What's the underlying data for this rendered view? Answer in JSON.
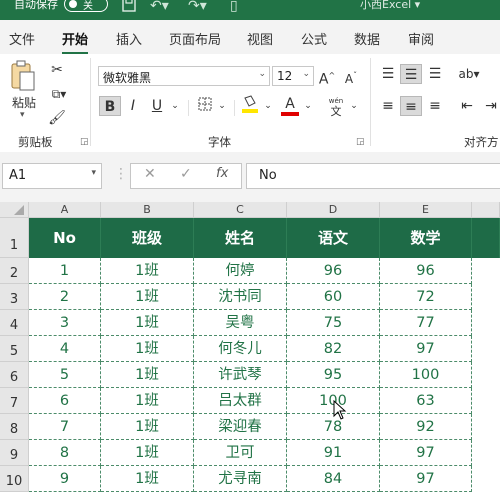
{
  "titlebar": {
    "autosave_label": "自动保存",
    "toggle_label": "关",
    "app_title": "小西Excel ▾"
  },
  "menu": [
    "文件",
    "开始",
    "插入",
    "页面布局",
    "视图",
    "公式",
    "数据",
    "审阅"
  ],
  "ribbon": {
    "paste_label": "粘贴",
    "paste_arrow": "▾",
    "clipboard_group": "剪贴板",
    "font_group": "字体",
    "align_group": "对齐方",
    "font_name": "微软雅黑",
    "font_size": "12",
    "bold": "B",
    "italic": "I",
    "underline": "U",
    "grow_font": "A",
    "shrink_font": "A",
    "font_color_glyph": "A",
    "wen": "wén",
    "wen_char": "文"
  },
  "formula_bar": {
    "name_box": "A1",
    "cancel_glyph": "✕",
    "enter_glyph": "✓",
    "fx_label": "fx",
    "formula": "No"
  },
  "columns": [
    "A",
    "B",
    "C",
    "D",
    "E"
  ],
  "table": {
    "headers": [
      "No",
      "班级",
      "姓名",
      "语文",
      "数学"
    ],
    "rows": [
      [
        "1",
        "1班",
        "何婷",
        "96",
        "96"
      ],
      [
        "2",
        "1班",
        "沈书同",
        "60",
        "72"
      ],
      [
        "3",
        "1班",
        "吴粤",
        "75",
        "77"
      ],
      [
        "4",
        "1班",
        "何冬儿",
        "82",
        "97"
      ],
      [
        "5",
        "1班",
        "许武琴",
        "95",
        "100"
      ],
      [
        "6",
        "1班",
        "吕太群",
        "100",
        "63"
      ],
      [
        "7",
        "1班",
        "梁迎春",
        "78",
        "92"
      ],
      [
        "8",
        "1班",
        "卫可",
        "91",
        "97"
      ],
      [
        "9",
        "1班",
        "尤寻南",
        "84",
        "97"
      ]
    ]
  },
  "row_numbers": [
    "1",
    "2",
    "3",
    "4",
    "5",
    "6",
    "7",
    "8",
    "9",
    "10"
  ],
  "colors": {
    "accent": "#217346",
    "header_fill": "#1e6b47",
    "highlight_yellow": "#ffe600",
    "font_red": "#e00000"
  }
}
